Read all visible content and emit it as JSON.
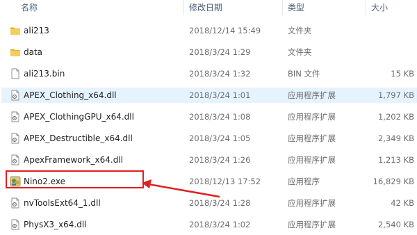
{
  "columns": {
    "name": "名称",
    "date": "修改日期",
    "type": "类型",
    "size": "大小"
  },
  "files": [
    {
      "name": "ali213",
      "date": "2018/12/14 15:49",
      "type": "文件夹",
      "size": "",
      "icon": "folder-icon"
    },
    {
      "name": "data",
      "date": "2018/3/24 1:29",
      "type": "文件夹",
      "size": "",
      "icon": "folder-icon"
    },
    {
      "name": "ali213.bin",
      "date": "2018/3/24 1:32",
      "type": "BIN 文件",
      "size": "15 KB",
      "icon": "file-icon"
    },
    {
      "name": "APEX_Clothing_x64.dll",
      "date": "2018/3/24 1:01",
      "type": "应用程序扩展",
      "size": "1,797 KB",
      "icon": "dll-icon",
      "selected": true
    },
    {
      "name": "APEX_ClothingGPU_x64.dll",
      "date": "2018/3/24 1:08",
      "type": "应用程序扩展",
      "size": "1,202 KB",
      "icon": "dll-icon"
    },
    {
      "name": "APEX_Destructible_x64.dll",
      "date": "2018/3/24 1:05",
      "type": "应用程序扩展",
      "size": "2,349 KB",
      "icon": "dll-icon"
    },
    {
      "name": "ApexFramework_x64.dll",
      "date": "2018/3/24 1:26",
      "type": "应用程序扩展",
      "size": "1,213 KB",
      "icon": "dll-icon"
    },
    {
      "name": "Nino2.exe",
      "date": "2018/12/13 17:52",
      "type": "应用程序",
      "size": "16,829 KB",
      "icon": "exe-icon",
      "annotated": true
    },
    {
      "name": "nvToolsExt64_1.dll",
      "date": "2018/3/24 1:28",
      "type": "应用程序扩展",
      "size": "42 KB",
      "icon": "dll-icon"
    },
    {
      "name": "PhysX3_x64.dll",
      "date": "2018/3/24 1:02",
      "type": "应用程序扩展",
      "size": "2,540 KB",
      "icon": "dll-icon"
    }
  ],
  "colors": {
    "selection": "#e5f3ff",
    "annotation": "#e0201f",
    "folder": "#f4c542"
  }
}
